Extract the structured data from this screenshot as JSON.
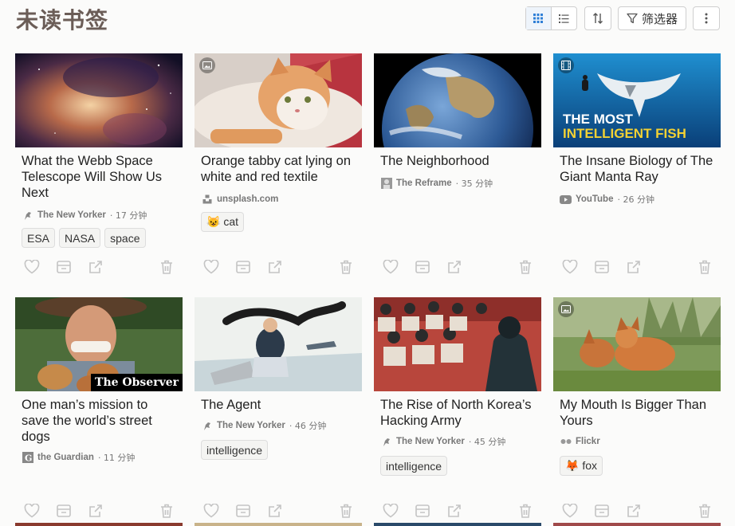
{
  "header": {
    "title": "未读书签",
    "filter_label": "筛选器",
    "icons": [
      "grid-view-icon",
      "list-view-icon",
      "sort-icon",
      "filter-icon",
      "more-icon"
    ]
  },
  "colors": {
    "title": "#6b5d57",
    "icon_grey": "#c4c4c4",
    "accent_blue": "#2f7fd6"
  },
  "cards": [
    {
      "title": "What the Webb Space Telescope Will Show Us Next",
      "source": "The New Yorker",
      "duration": "· 17 分钟",
      "tags": [
        "ESA",
        "NASA",
        "space"
      ]
    },
    {
      "title": "Orange tabby cat lying on white and red textile",
      "source": "unsplash.com",
      "duration": "",
      "tags": [
        "😺 cat"
      ]
    },
    {
      "title": "The Neighborhood",
      "source": "The Reframe",
      "duration": "· 35 分钟",
      "tags": []
    },
    {
      "title": "The Insane Biology of The Giant Manta Ray",
      "source": "YouTube",
      "duration": "· 26 分钟",
      "tags": [],
      "thumb_text": [
        "THE MOST",
        "INTELLIGENT FISH"
      ]
    },
    {
      "title": "One man’s mission to save the world’s street dogs",
      "source": "the Guardian",
      "duration": "· 11 分钟",
      "tags": [],
      "thumb_text": [
        "The Observer"
      ]
    },
    {
      "title": "The Agent",
      "source": "The New Yorker",
      "duration": "· 46 分钟",
      "tags": [
        "intelligence"
      ]
    },
    {
      "title": "The Rise of North Korea’s Hacking Army",
      "source": "The New Yorker",
      "duration": "· 45 分钟",
      "tags": [
        "intelligence"
      ]
    },
    {
      "title": "My Mouth Is Bigger Than Yours",
      "source": "Flickr",
      "duration": "",
      "tags": [
        "🦊 fox"
      ]
    }
  ]
}
